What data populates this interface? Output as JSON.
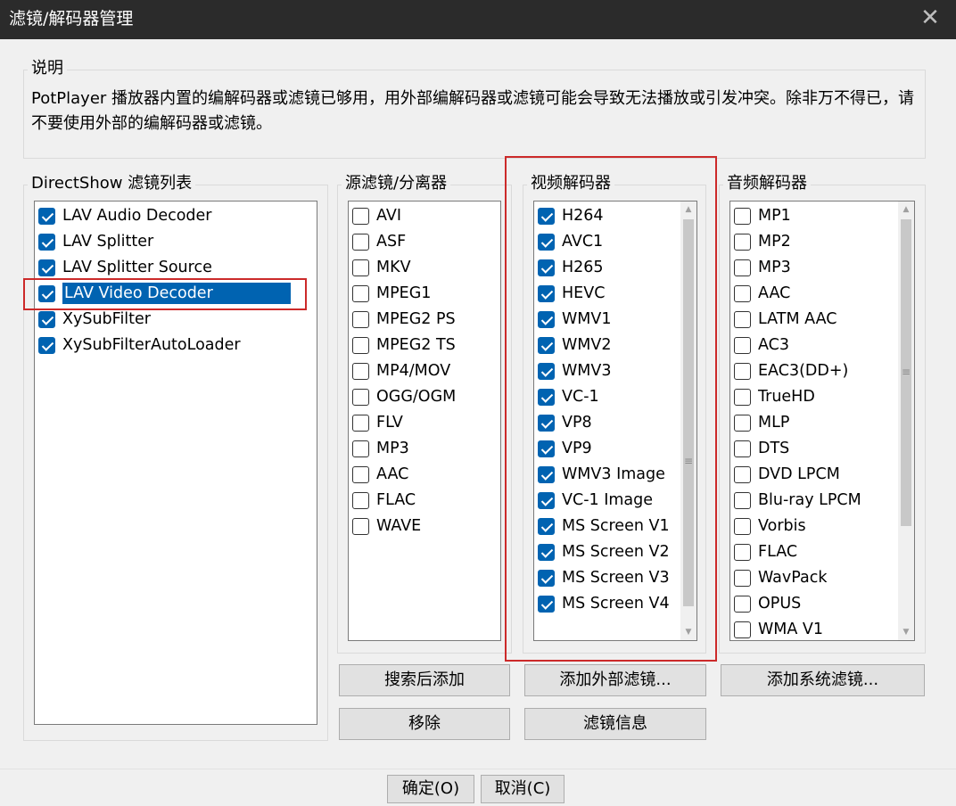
{
  "window": {
    "title": "滤镜/解码器管理",
    "close_glyph": "✕"
  },
  "description": {
    "label": "说明",
    "text": "PotPlayer 播放器内置的编解码器或滤镜已够用，用外部编解码器或滤镜可能会导致无法播放或引发冲突。除非万不得已，请不要使用外部的编解码器或滤镜。"
  },
  "directshow": {
    "label": "DirectShow 滤镜列表",
    "items": [
      {
        "label": "LAV Audio Decoder",
        "checked": true,
        "selected": false
      },
      {
        "label": "LAV Splitter",
        "checked": true,
        "selected": false
      },
      {
        "label": "LAV Splitter Source",
        "checked": true,
        "selected": false
      },
      {
        "label": "LAV Video Decoder",
        "checked": true,
        "selected": true
      },
      {
        "label": "XySubFilter",
        "checked": true,
        "selected": false
      },
      {
        "label": "XySubFilterAutoLoader",
        "checked": true,
        "selected": false
      }
    ]
  },
  "source": {
    "label": "源滤镜/分离器",
    "items": [
      {
        "label": "AVI",
        "checked": false
      },
      {
        "label": "ASF",
        "checked": false
      },
      {
        "label": "MKV",
        "checked": false
      },
      {
        "label": "MPEG1",
        "checked": false
      },
      {
        "label": "MPEG2 PS",
        "checked": false
      },
      {
        "label": "MPEG2 TS",
        "checked": false
      },
      {
        "label": "MP4/MOV",
        "checked": false
      },
      {
        "label": "OGG/OGM",
        "checked": false
      },
      {
        "label": "FLV",
        "checked": false
      },
      {
        "label": "MP3",
        "checked": false
      },
      {
        "label": "AAC",
        "checked": false
      },
      {
        "label": "FLAC",
        "checked": false
      },
      {
        "label": "WAVE",
        "checked": false
      }
    ]
  },
  "video": {
    "label": "视频解码器",
    "items": [
      {
        "label": "H264",
        "checked": true
      },
      {
        "label": "AVC1",
        "checked": true
      },
      {
        "label": "H265",
        "checked": true
      },
      {
        "label": "HEVC",
        "checked": true
      },
      {
        "label": "WMV1",
        "checked": true
      },
      {
        "label": "WMV2",
        "checked": true
      },
      {
        "label": "WMV3",
        "checked": true
      },
      {
        "label": "VC-1",
        "checked": true
      },
      {
        "label": "VP8",
        "checked": true
      },
      {
        "label": "VP9",
        "checked": true
      },
      {
        "label": "WMV3 Image",
        "checked": true
      },
      {
        "label": "VC-1 Image",
        "checked": true
      },
      {
        "label": "MS Screen V1",
        "checked": true
      },
      {
        "label": "MS Screen V2",
        "checked": true
      },
      {
        "label": "MS Screen V3",
        "checked": true
      },
      {
        "label": "MS Screen V4",
        "checked": true
      }
    ]
  },
  "audio": {
    "label": "音频解码器",
    "items": [
      {
        "label": "MP1",
        "checked": false
      },
      {
        "label": "MP2",
        "checked": false
      },
      {
        "label": "MP3",
        "checked": false
      },
      {
        "label": "AAC",
        "checked": false
      },
      {
        "label": "LATM AAC",
        "checked": false
      },
      {
        "label": "AC3",
        "checked": false
      },
      {
        "label": "EAC3(DD+)",
        "checked": false
      },
      {
        "label": "TrueHD",
        "checked": false
      },
      {
        "label": "MLP",
        "checked": false
      },
      {
        "label": "DTS",
        "checked": false
      },
      {
        "label": "DVD LPCM",
        "checked": false
      },
      {
        "label": "Blu-ray LPCM",
        "checked": false
      },
      {
        "label": "Vorbis",
        "checked": false
      },
      {
        "label": "FLAC",
        "checked": false
      },
      {
        "label": "WavPack",
        "checked": false
      },
      {
        "label": "OPUS",
        "checked": false
      },
      {
        "label": "WMA V1",
        "checked": false
      }
    ]
  },
  "buttons": {
    "search_add": "搜索后添加",
    "add_external": "添加外部滤镜...",
    "add_system": "添加系统滤镜...",
    "remove": "移除",
    "filter_info": "滤镜信息",
    "ok": "确定(O)",
    "cancel": "取消(C)"
  },
  "colors": {
    "accent": "#0063b1",
    "titlebar": "#2b2b2b",
    "highlight_box": "#cc2a2a"
  }
}
